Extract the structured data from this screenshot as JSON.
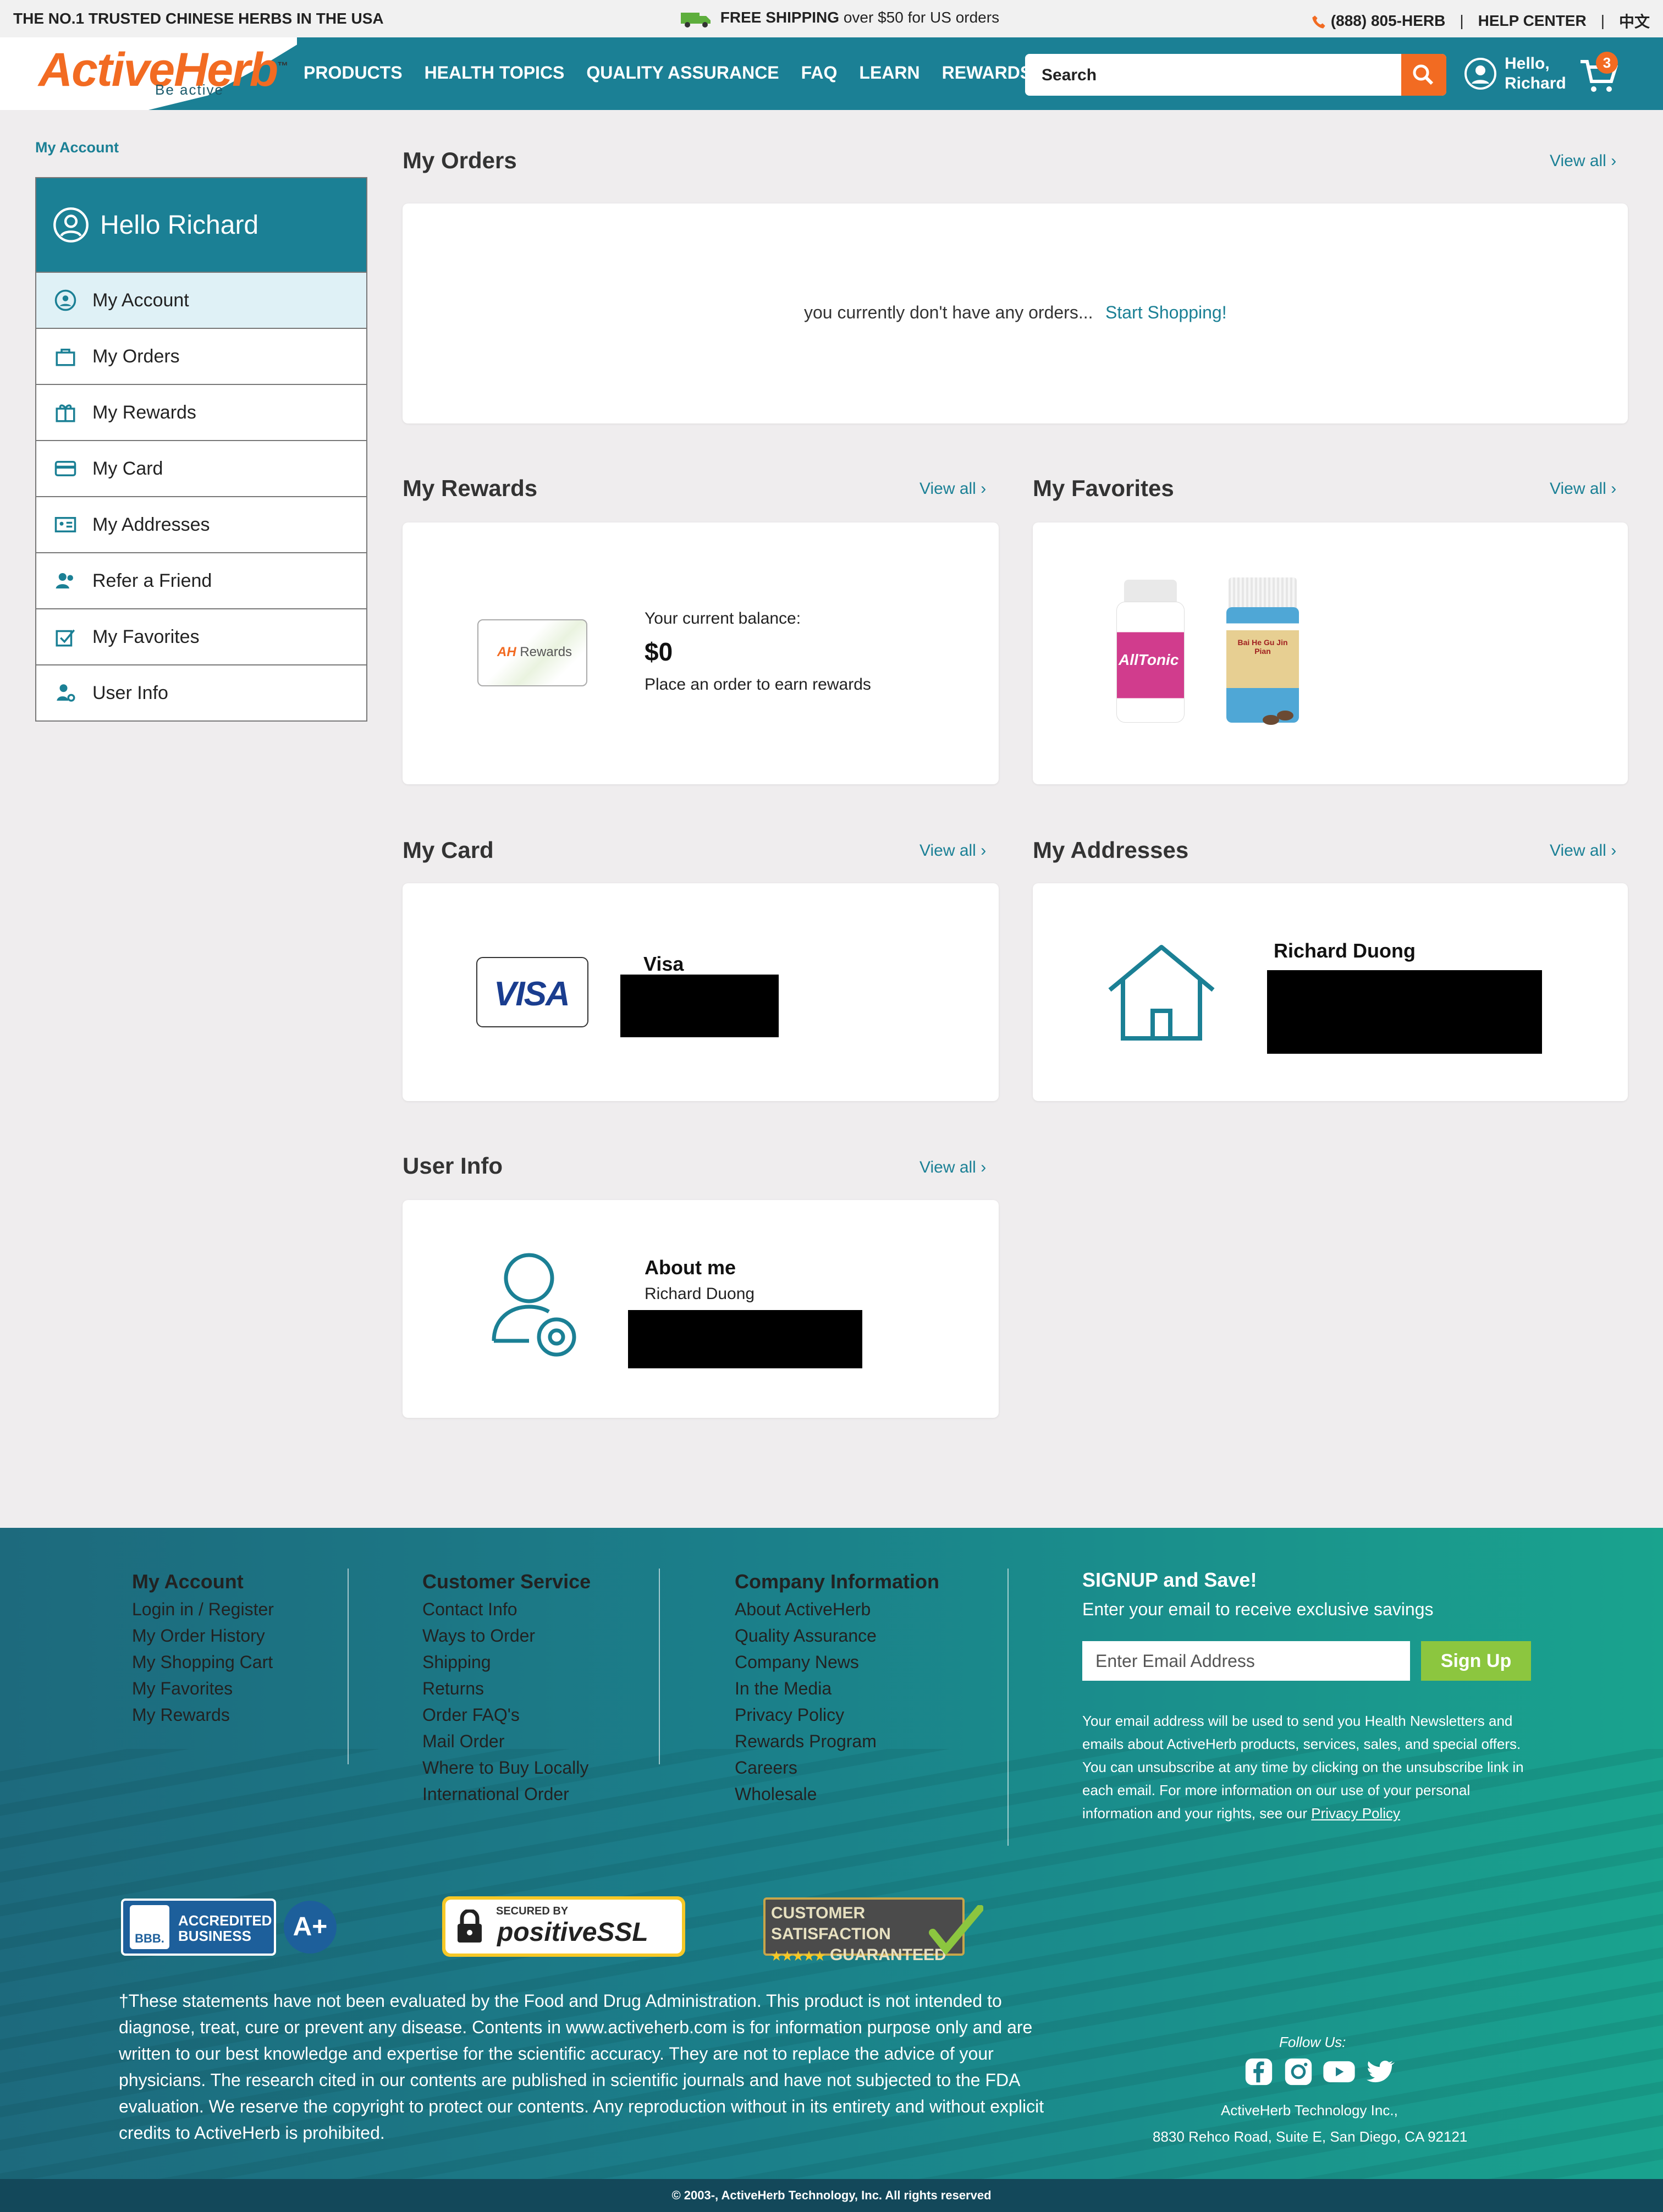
{
  "topbar": {
    "tagline": "THE NO.1 TRUSTED CHINESE HERBS IN THE USA",
    "shipping_bold": "FREE SHIPPING",
    "shipping_rest": "over $50 for US orders",
    "phone": "(888) 805-HERB",
    "sep1": "|",
    "help": "HELP CENTER",
    "sep2": "|",
    "lang": "中文"
  },
  "header": {
    "logo_active": "Active",
    "logo_herb": "Herb",
    "logo_tm": "™",
    "logo_tagline": "Be active",
    "menu": [
      "PRODUCTS",
      "HEALTH TOPICS",
      "QUALITY ASSURANCE",
      "FAQ",
      "LEARN",
      "REWARDS"
    ],
    "search_placeholder": "Search",
    "user_hello": "Hello,",
    "user_name": "Richard",
    "cart_count": "3"
  },
  "breadcrumb": "My Account",
  "sidebar": {
    "greeting": "Hello Richard",
    "items": [
      "My Account",
      "My Orders",
      "My Rewards",
      "My Card",
      "My Addresses",
      "Refer a Friend",
      "My Favorites",
      "User Info"
    ]
  },
  "orders": {
    "title": "My Orders",
    "view_all": "View all",
    "empty_text": "you currently don't have any orders...",
    "start_link": "Start Shopping!"
  },
  "rewards": {
    "title": "My Rewards",
    "view_all": "View all",
    "card_logo": "AH",
    "card_label": "Rewards",
    "balance_label": "Your current balance:",
    "balance": "$0",
    "hint": "Place an order to earn rewards"
  },
  "favorites": {
    "title": "My Favorites",
    "view_all": "View all",
    "product1_label": "AllTonic",
    "product2_label": "Bai He Gu Jin Pian"
  },
  "card": {
    "title": "My Card",
    "view_all": "View all",
    "brand_logo": "VISA",
    "brand": "Visa"
  },
  "addresses": {
    "title": "My Addresses",
    "view_all": "View all",
    "name": "Richard Duong"
  },
  "userinfo": {
    "title": "User Info",
    "view_all": "View all",
    "heading": "About me",
    "name": "Richard Duong"
  },
  "footer": {
    "col1": {
      "title": "My Account",
      "links": [
        "Login in / Register",
        "My Order History",
        "My Shopping Cart",
        "My Favorites",
        "My Rewards"
      ]
    },
    "col2": {
      "title": "Customer Service",
      "links": [
        "Contact Info",
        "Ways to Order",
        "Shipping",
        "Returns",
        "Order FAQ's",
        "Mail Order",
        "Where to Buy Locally",
        "International Order"
      ]
    },
    "col3": {
      "title": "Company Information",
      "links": [
        "About ActiveHerb",
        "Quality Assurance",
        "Company News",
        "In the Media",
        "Privacy Policy",
        "Rewards Program",
        "Careers",
        "Wholesale"
      ]
    },
    "signup_title": "SIGNUP and Save!",
    "signup_sub": "Enter your email to receive exclusive savings",
    "email_placeholder": "Enter Email Address",
    "signup_button": "Sign Up",
    "privacy_text": "Your email address will be used to send you Health Newsletters and emails about ActiveHerb products, services, sales, and special offers. You can unsubscribe at any time by clicking on the unsubscribe link in each email. For more information on our use of your personal information and your rights, see our",
    "privacy_link": "Privacy Policy",
    "bbb_line1": "ACCREDITED",
    "bbb_line2": "BUSINESS",
    "bbb_abbr": "BBB.",
    "bbb_rating": "A+",
    "ssl_top": "SECURED BY",
    "ssl_brand": "positiveSSL",
    "sat_line1": "CUSTOMER SATISFACTION",
    "sat_line2": "GUARANTEED",
    "sat_stars": "★★★★★",
    "disclaimer": "†These statements have not been evaluated by the Food and Drug Administration. This product is not intended to diagnose, treat, cure or prevent any disease. Contents in www.activeherb.com is for information purpose only and are written to our best knowledge and expertise for the scientific accuracy. They are not to replace the advice of your physicians. The research cited in our contents are published in scientific journals and have not subjected to the FDA evaluation. We reserve the copyright to protect our contents. Any reproduction without in its entirety and without explicit credits to ActiveHerb is prohibited.",
    "follow": "Follow Us:",
    "company": "ActiveHerb Technology Inc.,",
    "address": "8830 Rehco Road, Suite E, San Diego, CA 92121",
    "copyright": "© 2003-, ActiveHerb Technology, Inc. All rights reserved"
  },
  "colors": {
    "teal": "#1b8095",
    "orange": "#f26b22",
    "green_btn": "#8cc63f"
  }
}
